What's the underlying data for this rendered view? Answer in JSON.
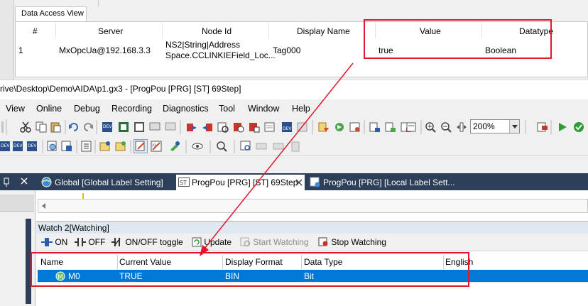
{
  "data_access_view": {
    "tab_label": "Data Access View",
    "columns": [
      "#",
      "Server",
      "Node Id",
      "Display Name",
      "Value",
      "Datatype"
    ],
    "row": {
      "index": "1",
      "server": "MxOpcUa@192.168.3.3",
      "node_id_line1": "NS2|String|Address",
      "node_id_line2": "Space.CCLINKIEField_Loc...",
      "display_name": "Tag000",
      "value": "true",
      "datatype": "Boolean"
    }
  },
  "window": {
    "title": "rive\\Desktop\\Demo\\AIDA\\p1.gx3 - [ProgPou [PRG] [ST] 69Step]"
  },
  "menu": [
    "View",
    "Online",
    "Debug",
    "Recording",
    "Diagnostics",
    "Tool",
    "Window",
    "Help"
  ],
  "toolbar": {
    "zoom": "200%"
  },
  "doc_tabs": {
    "global": "Global [Global Label Setting]",
    "progpou_st": "ProgPou [PRG] [ST] 69Step",
    "progpou_local": "ProgPou [PRG] [Local Label Sett..."
  },
  "watch": {
    "title": "Watch 2[Watching]",
    "buttons": {
      "on": "ON",
      "off": "OFF",
      "toggle": "ON/OFF toggle",
      "update": "Update",
      "start": "Start Watching",
      "stop": "Stop Watching"
    },
    "columns": [
      "Name",
      "Current Value",
      "Display Format",
      "Data Type",
      "English"
    ],
    "row": {
      "name": "M0",
      "current_value": "TRUE",
      "display_format": "BIN",
      "data_type": "Bit"
    }
  },
  "colors": {
    "highlight_red": "#e0182c",
    "selection_blue": "#0078d7",
    "tab_bar_dark": "#2c3e58"
  }
}
